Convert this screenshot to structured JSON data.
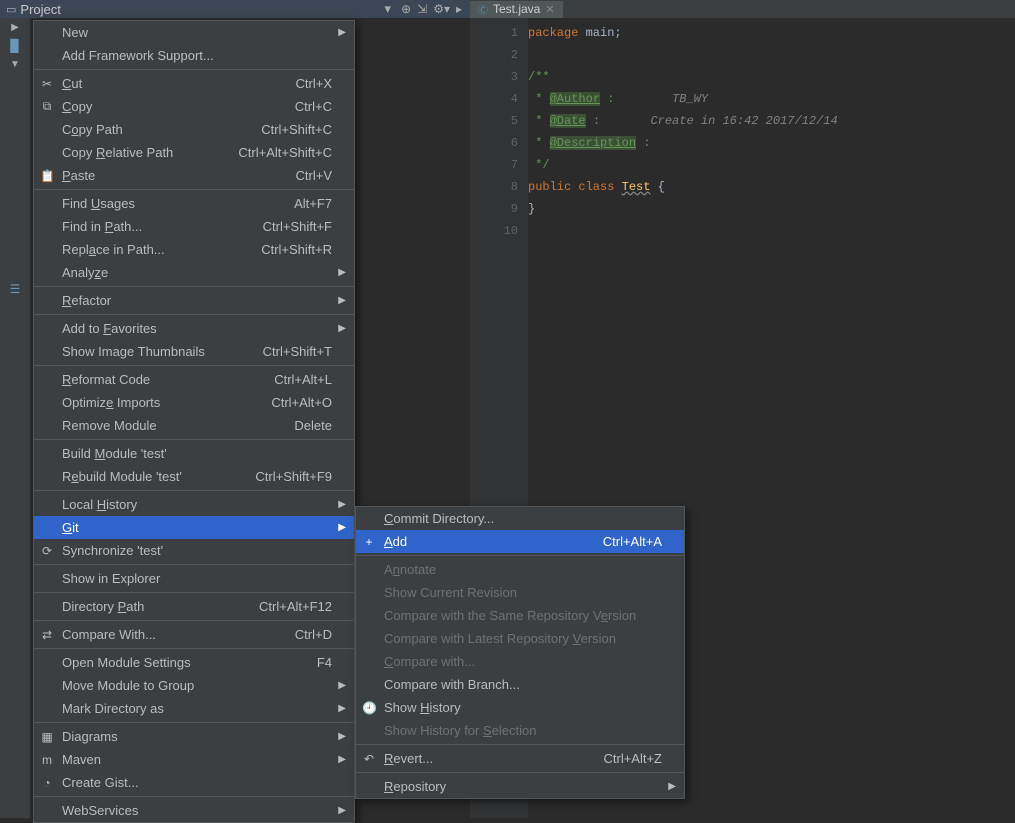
{
  "topbar": {
    "project_label": "Project"
  },
  "tab": {
    "name": "Test.java"
  },
  "code_lines": {
    "l1": "package main;",
    "l5_prefix": " *",
    "l5_date": "@Date",
    "l5_colon": ":",
    "l5_text": "Create in 16:42 2017/12/14",
    "l4_auth": "@Author",
    "l4_colon": ":",
    "l4_name": "TB_WY",
    "l6_desc": "@Description",
    "l6_colon": ":",
    "l8_kw1": "public class ",
    "l8_cls": "Test",
    "l8_brace": " {"
  },
  "menu_main": [
    {
      "label": "New",
      "arrow": true
    },
    {
      "label": "Add Framework Support..."
    },
    {
      "sep": true
    },
    {
      "label": "Cut",
      "icon": "✂",
      "accel": "Ctrl+X",
      "u": 0
    },
    {
      "label": "Copy",
      "icon": "⧉",
      "accel": "Ctrl+C",
      "u": 0
    },
    {
      "label": "Copy Path",
      "accel": "Ctrl+Shift+C",
      "u": 1
    },
    {
      "label": "Copy Relative Path",
      "accel": "Ctrl+Alt+Shift+C",
      "u": 5
    },
    {
      "label": "Paste",
      "icon": "📋",
      "accel": "Ctrl+V",
      "u": 0
    },
    {
      "sep": true
    },
    {
      "label": "Find Usages",
      "accel": "Alt+F7",
      "u": 5
    },
    {
      "label": "Find in Path...",
      "accel": "Ctrl+Shift+F",
      "u": 8
    },
    {
      "label": "Replace in Path...",
      "accel": "Ctrl+Shift+R",
      "u": 4
    },
    {
      "label": "Analyze",
      "arrow": true,
      "u": 5
    },
    {
      "sep": true
    },
    {
      "label": "Refactor",
      "arrow": true,
      "u": 0
    },
    {
      "sep": true
    },
    {
      "label": "Add to Favorites",
      "arrow": true,
      "u": 7
    },
    {
      "label": "Show Image Thumbnails",
      "accel": "Ctrl+Shift+T"
    },
    {
      "sep": true
    },
    {
      "label": "Reformat Code",
      "accel": "Ctrl+Alt+L",
      "u": 0
    },
    {
      "label": "Optimize Imports",
      "accel": "Ctrl+Alt+O",
      "u": 7
    },
    {
      "label": "Remove Module",
      "accel": "Delete"
    },
    {
      "sep": true
    },
    {
      "label": "Build Module 'test'",
      "u": 6
    },
    {
      "label": "Rebuild Module 'test'",
      "accel": "Ctrl+Shift+F9",
      "u": 1
    },
    {
      "sep": true
    },
    {
      "label": "Local History",
      "arrow": true,
      "u": 6
    },
    {
      "label": "Git",
      "arrow": true,
      "sel": true,
      "u": 0
    },
    {
      "label": "Synchronize 'test'",
      "icon": "⟳"
    },
    {
      "sep": true
    },
    {
      "label": "Show in Explorer"
    },
    {
      "sep": true
    },
    {
      "label": "Directory Path",
      "accel": "Ctrl+Alt+F12",
      "u": 10
    },
    {
      "sep": true
    },
    {
      "label": "Compare With...",
      "icon": "⇄",
      "accel": "Ctrl+D"
    },
    {
      "sep": true
    },
    {
      "label": "Open Module Settings",
      "accel": "F4"
    },
    {
      "label": "Move Module to Group",
      "arrow": true
    },
    {
      "label": "Mark Directory as",
      "arrow": true
    },
    {
      "sep": true
    },
    {
      "label": "Diagrams",
      "icon": "▦",
      "arrow": true
    },
    {
      "label": "Maven",
      "icon": "m",
      "arrow": true
    },
    {
      "label": "Create Gist...",
      "icon": "◔"
    },
    {
      "sep": true
    },
    {
      "label": "WebServices",
      "arrow": true
    }
  ],
  "menu_git": [
    {
      "label": "Commit Directory...",
      "u": 0
    },
    {
      "label": "Add",
      "icon": "+",
      "accel": "Ctrl+Alt+A",
      "sel": true,
      "u": 0
    },
    {
      "sep": true
    },
    {
      "label": "Annotate",
      "dis": true,
      "u": 1
    },
    {
      "label": "Show Current Revision",
      "dis": true
    },
    {
      "label": "Compare with the Same Repository Version",
      "dis": true,
      "u": 34
    },
    {
      "label": "Compare with Latest Repository Version",
      "dis": true,
      "u": 31
    },
    {
      "label": "Compare with...",
      "dis": true,
      "u": 0
    },
    {
      "label": "Compare with Branch..."
    },
    {
      "label": "Show History",
      "icon": "🕘",
      "u": 5
    },
    {
      "label": "Show History for Selection",
      "dis": true,
      "u": 17
    },
    {
      "sep": true
    },
    {
      "label": "Revert...",
      "icon": "↶",
      "accel": "Ctrl+Alt+Z",
      "u": 0
    },
    {
      "sep": true
    },
    {
      "label": "Repository",
      "arrow": true,
      "u": 0
    }
  ]
}
